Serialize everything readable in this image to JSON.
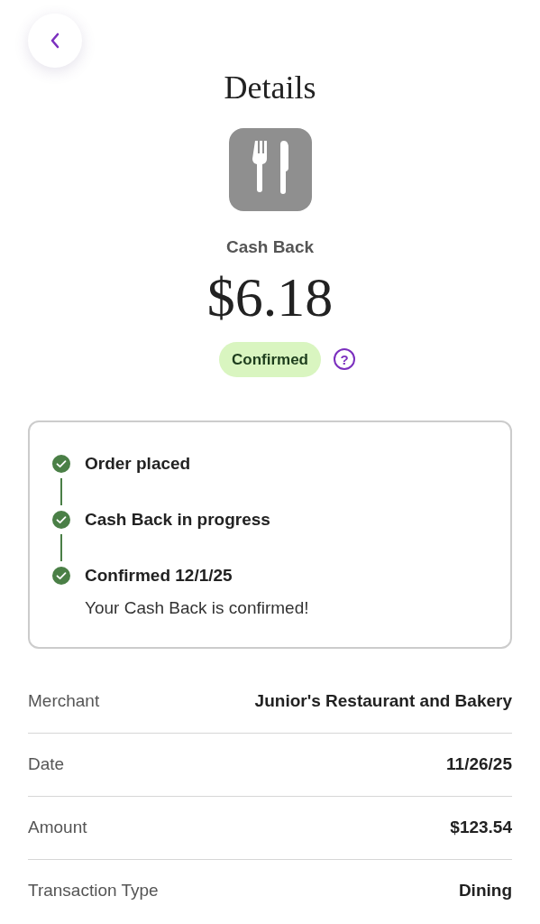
{
  "title": "Details",
  "category": {
    "kind": "dining"
  },
  "label": "Cash Back",
  "amount": "$6.18",
  "status": {
    "text": "Confirmed",
    "help": "?"
  },
  "steps": [
    {
      "title": "Order placed",
      "done": true
    },
    {
      "title": "Cash Back in progress",
      "done": true
    },
    {
      "title": "Confirmed 12/1/25",
      "done": true,
      "note": "Your Cash Back is confirmed!"
    }
  ],
  "details": [
    {
      "label": "Merchant",
      "value": "Junior's Restaurant and Bakery"
    },
    {
      "label": "Date",
      "value": "11/26/25"
    },
    {
      "label": "Amount",
      "value": "$123.54"
    },
    {
      "label": "Transaction Type",
      "value": "Dining"
    }
  ]
}
